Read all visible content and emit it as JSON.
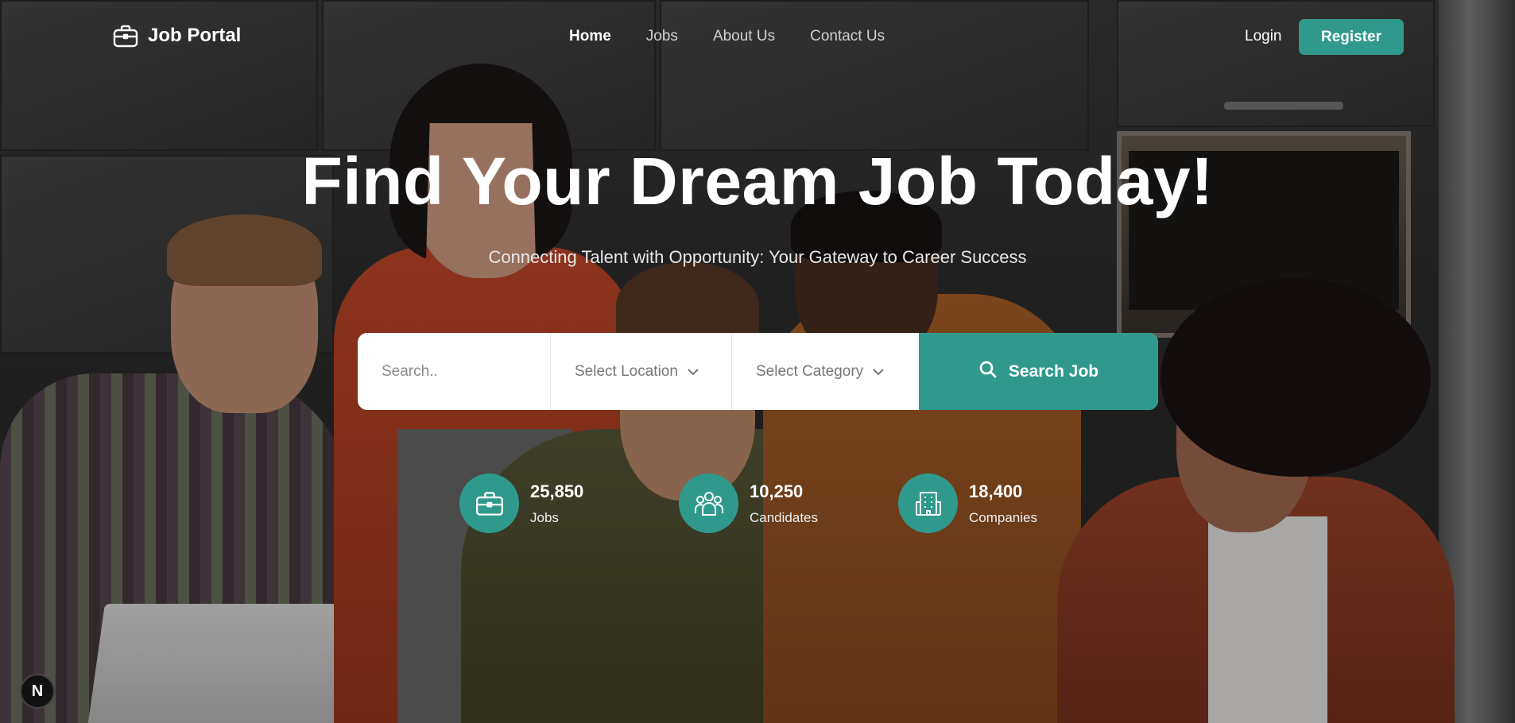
{
  "brand": {
    "name": "Job Portal",
    "icon": "briefcase-icon"
  },
  "nav": {
    "items": [
      {
        "label": "Home",
        "active": true
      },
      {
        "label": "Jobs",
        "active": false
      },
      {
        "label": "About Us",
        "active": false
      },
      {
        "label": "Contact Us",
        "active": false
      }
    ]
  },
  "auth": {
    "login_label": "Login",
    "register_label": "Register"
  },
  "hero": {
    "title": "Find Your Dream Job Today!",
    "subtitle": "Connecting Talent with Opportunity: Your Gateway to Career Success"
  },
  "search": {
    "placeholder": "Search..",
    "location_label": "Select Location",
    "category_label": "Select Category",
    "button_label": "Search Job"
  },
  "stats": [
    {
      "value": "25,850",
      "label": "Jobs",
      "icon": "briefcase-icon"
    },
    {
      "value": "10,250",
      "label": "Candidates",
      "icon": "users-icon"
    },
    {
      "value": "18,400",
      "label": "Companies",
      "icon": "building-icon"
    }
  ],
  "badge": {
    "label": "N"
  },
  "colors": {
    "accent": "#2f9a8c",
    "white": "#ffffff"
  }
}
